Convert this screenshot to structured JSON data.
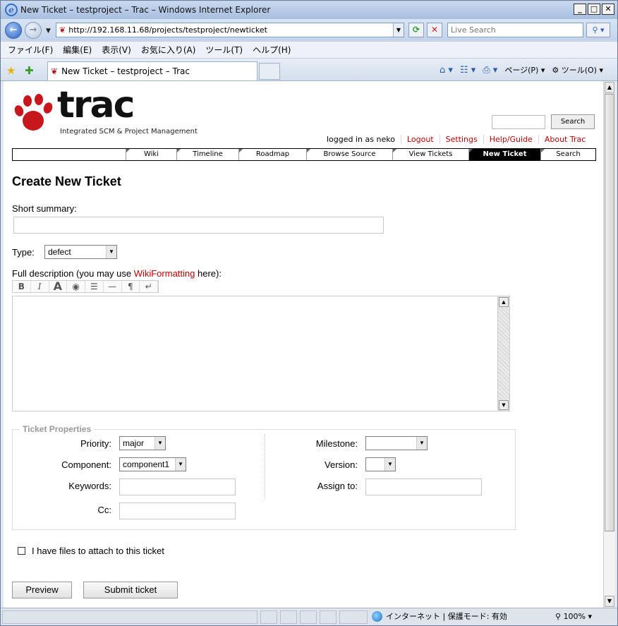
{
  "window": {
    "title": "New Ticket – testproject – Trac – Windows Internet Explorer"
  },
  "browser": {
    "address": "http://192.168.11.68/projects/testproject/newticket",
    "search_placeholder": "Live Search",
    "menu": [
      "ファイル(F)",
      "編集(E)",
      "表示(V)",
      "お気に入り(A)",
      "ツール(T)",
      "ヘルプ(H)"
    ],
    "tab_title": "New Ticket – testproject – Trac",
    "cmd_page": "ページ(P)",
    "cmd_tools": "ツール(O)"
  },
  "trac": {
    "tagline": "Integrated SCM & Project Management",
    "search_button": "Search",
    "metanav": {
      "logged_in": "logged in as neko",
      "logout": "Logout",
      "settings": "Settings",
      "help": "Help/Guide",
      "about": "About Trac"
    },
    "mainnav": [
      "Wiki",
      "Timeline",
      "Roadmap",
      "Browse Source",
      "View Tickets",
      "New Ticket",
      "Search"
    ],
    "page_title": "Create New Ticket",
    "summary_label": "Short summary:",
    "type_label": "Type:",
    "type_value": "defect",
    "desc_label_pre": "Full description (you may use ",
    "desc_link": "WikiFormatting",
    "desc_label_post": " here):",
    "toolbar": [
      "B",
      "I",
      "A",
      "◉",
      "☰",
      "—",
      "¶",
      "↵"
    ],
    "props_legend": "Ticket Properties",
    "props": {
      "priority_label": "Priority:",
      "priority_value": "major",
      "component_label": "Component:",
      "component_value": "component1",
      "keywords_label": "Keywords:",
      "cc_label": "Cc:",
      "milestone_label": "Milestone:",
      "version_label": "Version:",
      "assign_label": "Assign to:"
    },
    "attach_label": "I have files to attach to this ticket",
    "preview_button": "Preview",
    "submit_button": "Submit ticket"
  },
  "status": {
    "zone": "インターネット | 保護モード: 有効",
    "zoom": "100%"
  },
  "colors": {
    "link": "#bb0000",
    "nav_active": "#000000"
  }
}
